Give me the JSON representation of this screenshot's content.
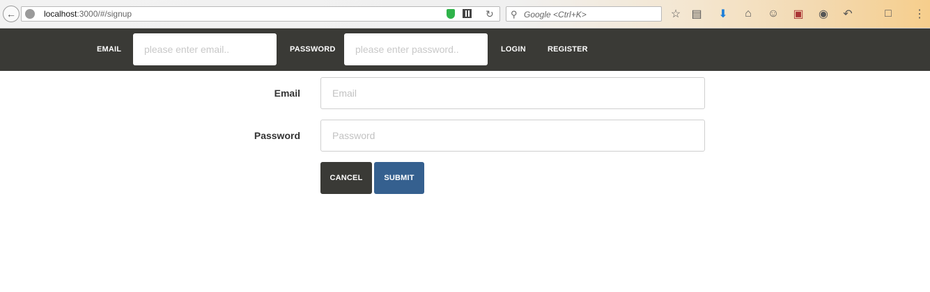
{
  "browser": {
    "url_host": "localhost",
    "url_path": ":3000/#/signup",
    "search_placeholder": "Google <Ctrl+K>"
  },
  "navbar": {
    "email_label": "EMAIL",
    "email_placeholder": "please enter email..",
    "password_label": "PASSWORD",
    "password_placeholder": "please enter password..",
    "login_label": "LOGIN",
    "register_label": "REGISTER"
  },
  "signup_form": {
    "email_label": "Email",
    "email_placeholder": "Email",
    "password_label": "Password",
    "password_placeholder": "Password",
    "cancel_label": "CANCEL",
    "submit_label": "SUBMIT"
  },
  "colors": {
    "nav_background": "#3a3a36",
    "cancel_button": "#3a3a36",
    "submit_button": "#35608f"
  }
}
